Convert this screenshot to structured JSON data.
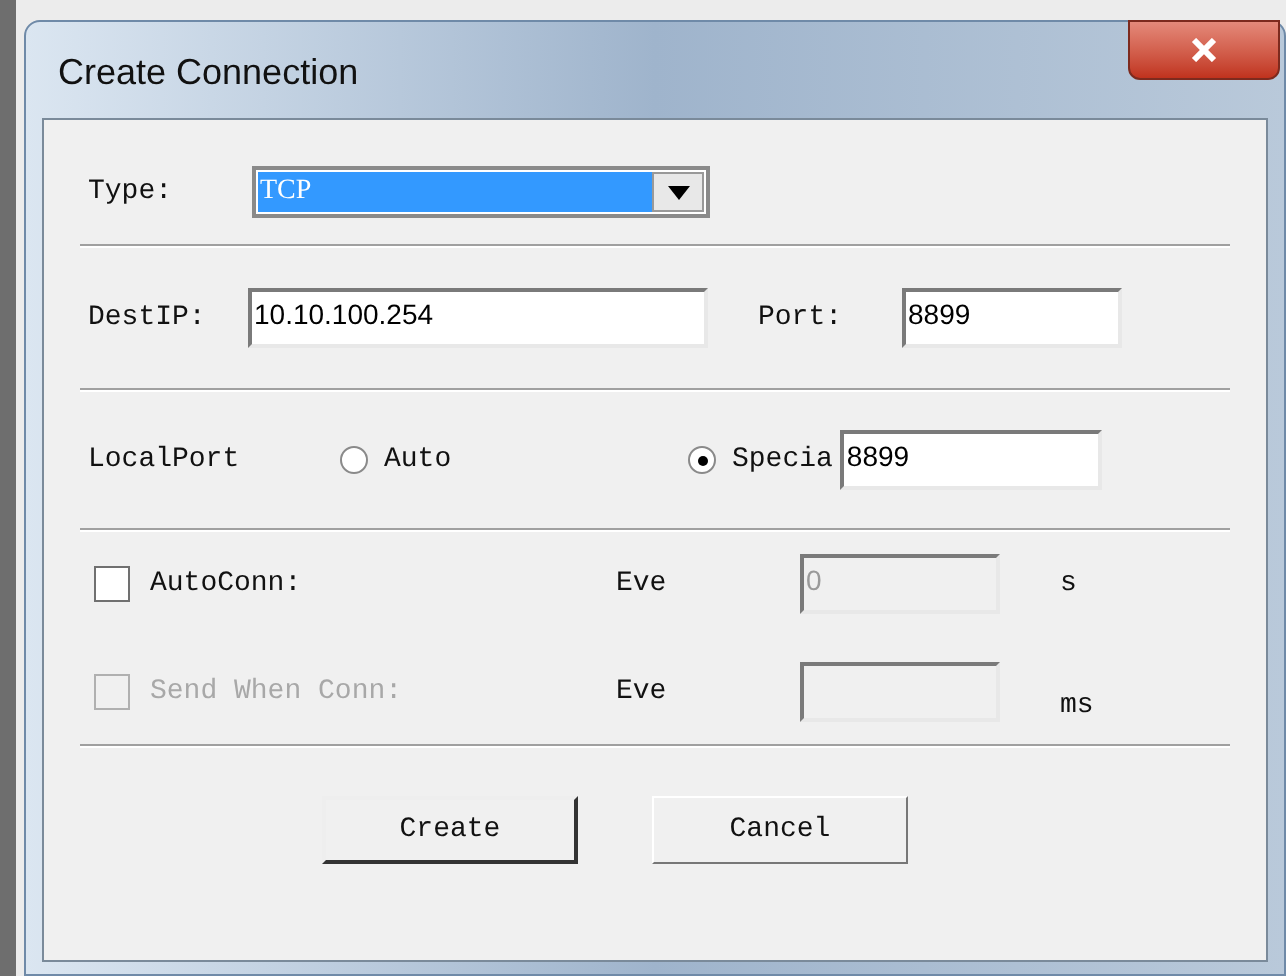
{
  "window": {
    "title": "Create Connection"
  },
  "type": {
    "label": "Type:",
    "value": "TCP"
  },
  "dest_ip": {
    "label": "DestIP:",
    "value": "10.10.100.254"
  },
  "port": {
    "label": "Port:",
    "value": "8899"
  },
  "local_port": {
    "label": "LocalPort",
    "options": [
      {
        "label": "Auto",
        "selected": false
      },
      {
        "label": "Specia",
        "selected": true
      }
    ],
    "value": "8899"
  },
  "timers": [
    {
      "label": "AutoConn:",
      "checked": false,
      "disabled": false,
      "interval_label": "Eve",
      "value": "0",
      "field_disabled": true,
      "unit": "s"
    },
    {
      "label": "Send When Conn:",
      "checked": false,
      "disabled": true,
      "interval_label": "Eve",
      "field_disabled": true,
      "unit": "ms"
    }
  ],
  "buttons": [
    {
      "label": "Create",
      "default": true
    },
    {
      "label": "Cancel",
      "default": false
    }
  ]
}
